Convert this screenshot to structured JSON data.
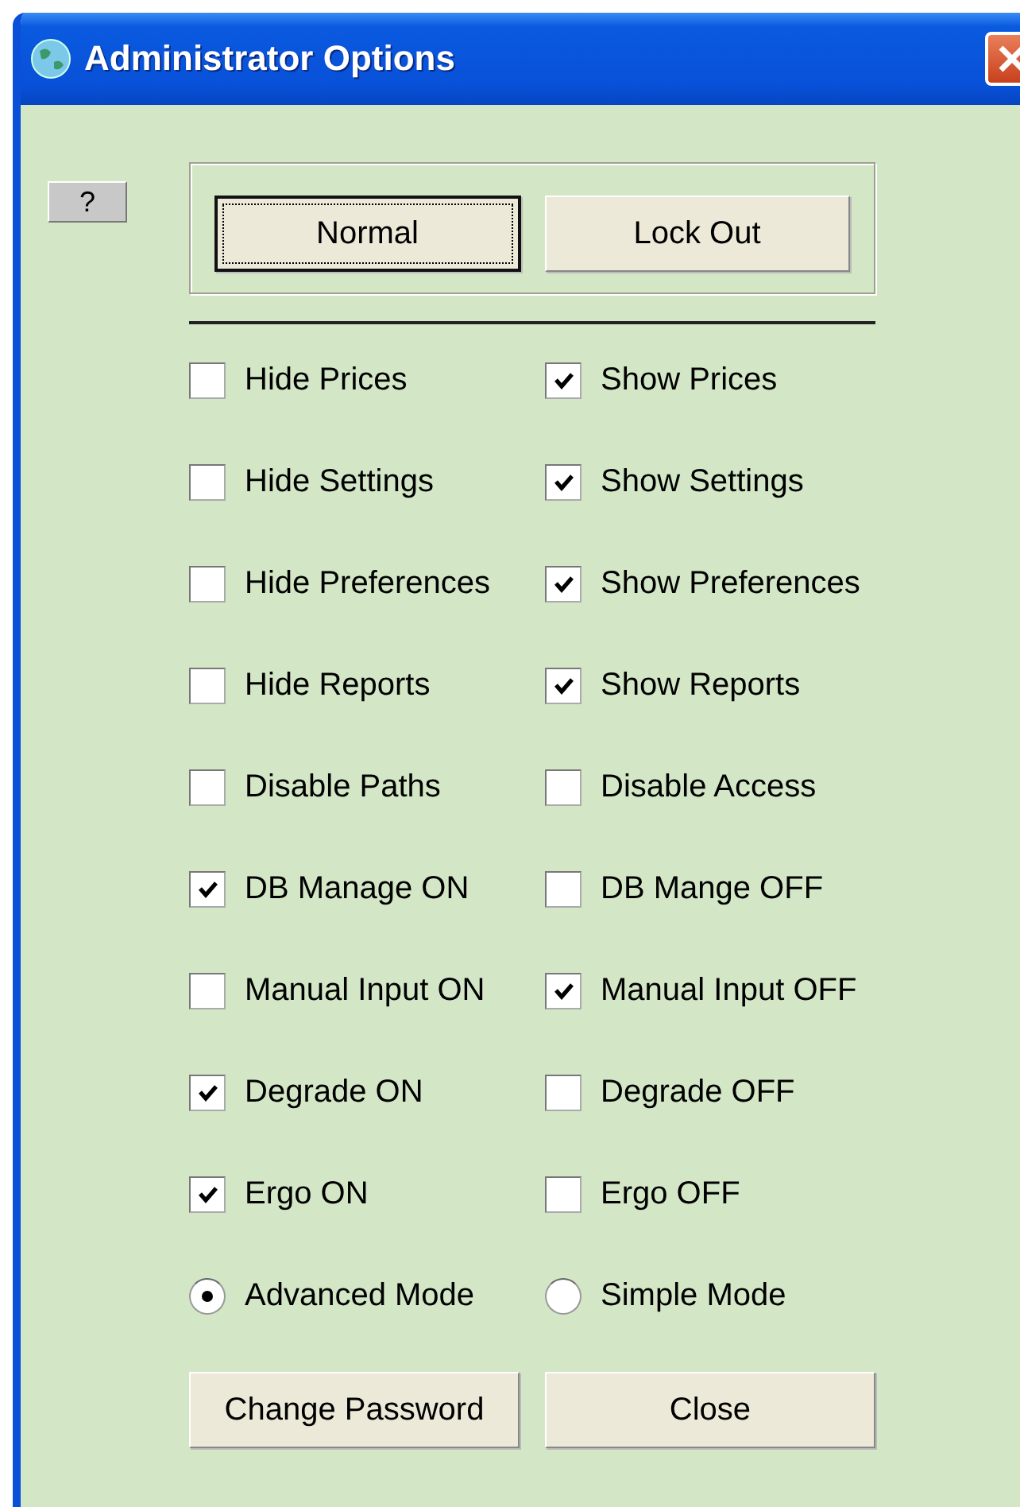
{
  "window": {
    "title": "Administrator Options"
  },
  "help_button": "?",
  "mode_buttons": [
    {
      "label": "Normal",
      "selected": true
    },
    {
      "label": "Lock Out",
      "selected": false
    }
  ],
  "options": [
    {
      "left": {
        "label": "Hide Prices",
        "checked": false
      },
      "right": {
        "label": "Show Prices",
        "checked": true
      }
    },
    {
      "left": {
        "label": "Hide Settings",
        "checked": false
      },
      "right": {
        "label": "Show Settings",
        "checked": true
      }
    },
    {
      "left": {
        "label": "Hide Preferences",
        "checked": false
      },
      "right": {
        "label": "Show Preferences",
        "checked": true
      }
    },
    {
      "left": {
        "label": "Hide Reports",
        "checked": false
      },
      "right": {
        "label": "Show Reports",
        "checked": true
      }
    },
    {
      "left": {
        "label": "Disable Paths",
        "checked": false
      },
      "right": {
        "label": "Disable Access",
        "checked": false
      }
    },
    {
      "left": {
        "label": "DB Manage ON",
        "checked": true
      },
      "right": {
        "label": "DB Mange OFF",
        "checked": false
      }
    },
    {
      "left": {
        "label": "Manual Input ON",
        "checked": false
      },
      "right": {
        "label": "Manual Input OFF",
        "checked": true
      }
    },
    {
      "left": {
        "label": "Degrade ON",
        "checked": true
      },
      "right": {
        "label": "Degrade OFF",
        "checked": false
      }
    },
    {
      "left": {
        "label": "Ergo ON",
        "checked": true
      },
      "right": {
        "label": "Ergo OFF",
        "checked": false
      }
    }
  ],
  "modes": [
    {
      "label": "Advanced Mode",
      "selected": true
    },
    {
      "label": "Simple Mode",
      "selected": false
    }
  ],
  "buttons": [
    "Change Password",
    "Close"
  ]
}
